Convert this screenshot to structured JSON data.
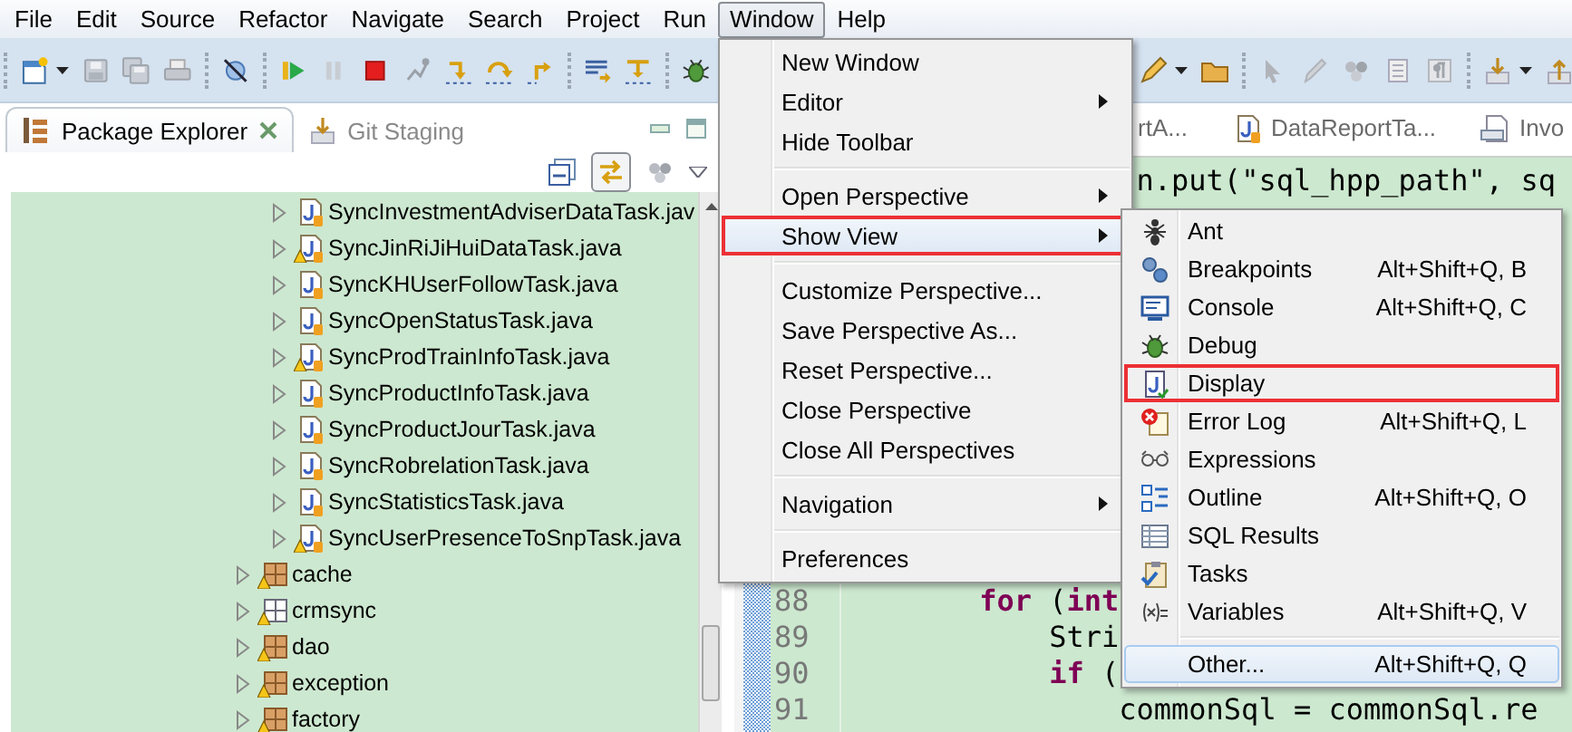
{
  "menu_bar": [
    {
      "label": "File",
      "selected": false
    },
    {
      "label": "Edit",
      "selected": false
    },
    {
      "label": "Source",
      "selected": false
    },
    {
      "label": "Refactor",
      "selected": false
    },
    {
      "label": "Navigate",
      "selected": false
    },
    {
      "label": "Search",
      "selected": false
    },
    {
      "label": "Project",
      "selected": false
    },
    {
      "label": "Run",
      "selected": false
    },
    {
      "label": "Window",
      "selected": true
    },
    {
      "label": "Help",
      "selected": false
    }
  ],
  "package_explorer": {
    "tabs": [
      {
        "label": "Package Explorer",
        "selected": true
      },
      {
        "label": "Git Staging",
        "selected": false
      }
    ],
    "link_with_editor": {
      "on": true
    },
    "tree": {
      "continued_children": [
        {
          "kind": "java_file",
          "label": "SyncInvestmentAdviserDataTask.jav",
          "warning": false,
          "expanded": false
        },
        {
          "kind": "java_file",
          "label": "SyncJinRiJiHuiDataTask.java",
          "warning": true,
          "expanded": false
        },
        {
          "kind": "java_file",
          "label": "SyncKHUserFollowTask.java",
          "warning": false,
          "expanded": false
        },
        {
          "kind": "java_file",
          "label": "SyncOpenStatusTask.java",
          "warning": false,
          "expanded": false
        },
        {
          "kind": "java_file",
          "label": "SyncProdTrainInfoTask.java",
          "warning": true,
          "expanded": false
        },
        {
          "kind": "java_file",
          "label": "SyncProductInfoTask.java",
          "warning": false,
          "expanded": false
        },
        {
          "kind": "java_file",
          "label": "SyncProductJourTask.java",
          "warning": false,
          "expanded": false
        },
        {
          "kind": "java_file",
          "label": "SyncRobrelationTask.java",
          "warning": false,
          "expanded": false
        },
        {
          "kind": "java_file",
          "label": "SyncStatisticsTask.java",
          "warning": false,
          "expanded": false
        },
        {
          "kind": "java_file",
          "label": "SyncUserPresenceToSnpTask.java",
          "warning": true,
          "expanded": false
        }
      ],
      "items": [
        {
          "kind": "package",
          "label": "cache",
          "warning": true,
          "expanded": false
        },
        {
          "kind": "empty_package",
          "label": "crmsync",
          "warning": true,
          "expanded": false
        },
        {
          "kind": "package",
          "label": "dao",
          "warning": true,
          "expanded": false
        },
        {
          "kind": "package",
          "label": "exception",
          "warning": true,
          "expanded": false
        },
        {
          "kind": "package",
          "label": "factory",
          "warning": true,
          "expanded": false
        }
      ]
    }
  },
  "editor": {
    "tabs": [
      {
        "label": "rtA...",
        "selected": false
      },
      {
        "label": "DataReportTa...",
        "selected": false
      },
      {
        "label": "Invo",
        "selected": false
      }
    ],
    "code_lines": [
      {
        "text": "                 n.put(\"sql_hpp_path\", sq"
      },
      {
        "number": "88",
        "text": "        **for** (**int**"
      },
      {
        "number": "89",
        "text": "            Stri"
      },
      {
        "number": "90",
        "text": "            **if** ("
      },
      {
        "number": "91",
        "text": "                commonSql = commonSql.re"
      }
    ]
  },
  "window_menu": {
    "items": [
      {
        "kind": "item",
        "label": "New Window",
        "submenu": false,
        "selected": false,
        "annotated": false
      },
      {
        "kind": "item",
        "label": "Editor",
        "submenu": true,
        "selected": false,
        "annotated": false
      },
      {
        "kind": "item",
        "label": "Hide Toolbar",
        "submenu": false,
        "selected": false,
        "annotated": false
      },
      {
        "kind": "separator"
      },
      {
        "kind": "item",
        "label": "Open Perspective",
        "submenu": true,
        "selected": false,
        "annotated": false
      },
      {
        "kind": "item",
        "label": "Show View",
        "submenu": true,
        "selected": true,
        "annotated": true
      },
      {
        "kind": "separator"
      },
      {
        "kind": "item",
        "label": "Customize Perspective...",
        "submenu": false,
        "selected": false,
        "annotated": false
      },
      {
        "kind": "item",
        "label": "Save Perspective As...",
        "submenu": false,
        "selected": false,
        "annotated": false
      },
      {
        "kind": "item",
        "label": "Reset Perspective...",
        "submenu": false,
        "selected": false,
        "annotated": false
      },
      {
        "kind": "item",
        "label": "Close Perspective",
        "submenu": false,
        "selected": false,
        "annotated": false
      },
      {
        "kind": "item",
        "label": "Close All Perspectives",
        "submenu": false,
        "selected": false,
        "annotated": false
      },
      {
        "kind": "separator"
      },
      {
        "kind": "item",
        "label": "Navigation",
        "submenu": true,
        "selected": false,
        "annotated": false
      },
      {
        "kind": "separator"
      },
      {
        "kind": "item",
        "label": "Preferences",
        "submenu": false,
        "selected": false,
        "annotated": false
      }
    ]
  },
  "show_view_menu": {
    "items": [
      {
        "kind": "item",
        "label": "Ant",
        "selected": false,
        "annotated": false
      },
      {
        "kind": "item",
        "label": "Breakpoints",
        "shortcut": "Alt+Shift+Q, B",
        "selected": false,
        "annotated": false
      },
      {
        "kind": "item",
        "label": "Console",
        "shortcut": "Alt+Shift+Q, C",
        "selected": false,
        "annotated": false
      },
      {
        "kind": "item",
        "label": "Debug",
        "selected": false,
        "annotated": false
      },
      {
        "kind": "item",
        "label": "Display",
        "selected": false,
        "annotated": true
      },
      {
        "kind": "item",
        "label": "Error Log",
        "shortcut": "Alt+Shift+Q, L",
        "selected": false,
        "annotated": false
      },
      {
        "kind": "item",
        "label": "Expressions",
        "selected": false,
        "annotated": false
      },
      {
        "kind": "item",
        "label": "Outline",
        "shortcut": "Alt+Shift+Q, O",
        "selected": false,
        "annotated": false
      },
      {
        "kind": "item",
        "label": "SQL Results",
        "selected": false,
        "annotated": false
      },
      {
        "kind": "item",
        "label": "Tasks",
        "selected": false,
        "annotated": false
      },
      {
        "kind": "item",
        "label": "Variables",
        "shortcut": "Alt+Shift+Q, V",
        "selected": false,
        "annotated": false
      },
      {
        "kind": "separator"
      },
      {
        "kind": "item",
        "label": "Other...",
        "shortcut": "Alt+Shift+Q, Q",
        "selected": true,
        "annotated": false
      }
    ]
  }
}
